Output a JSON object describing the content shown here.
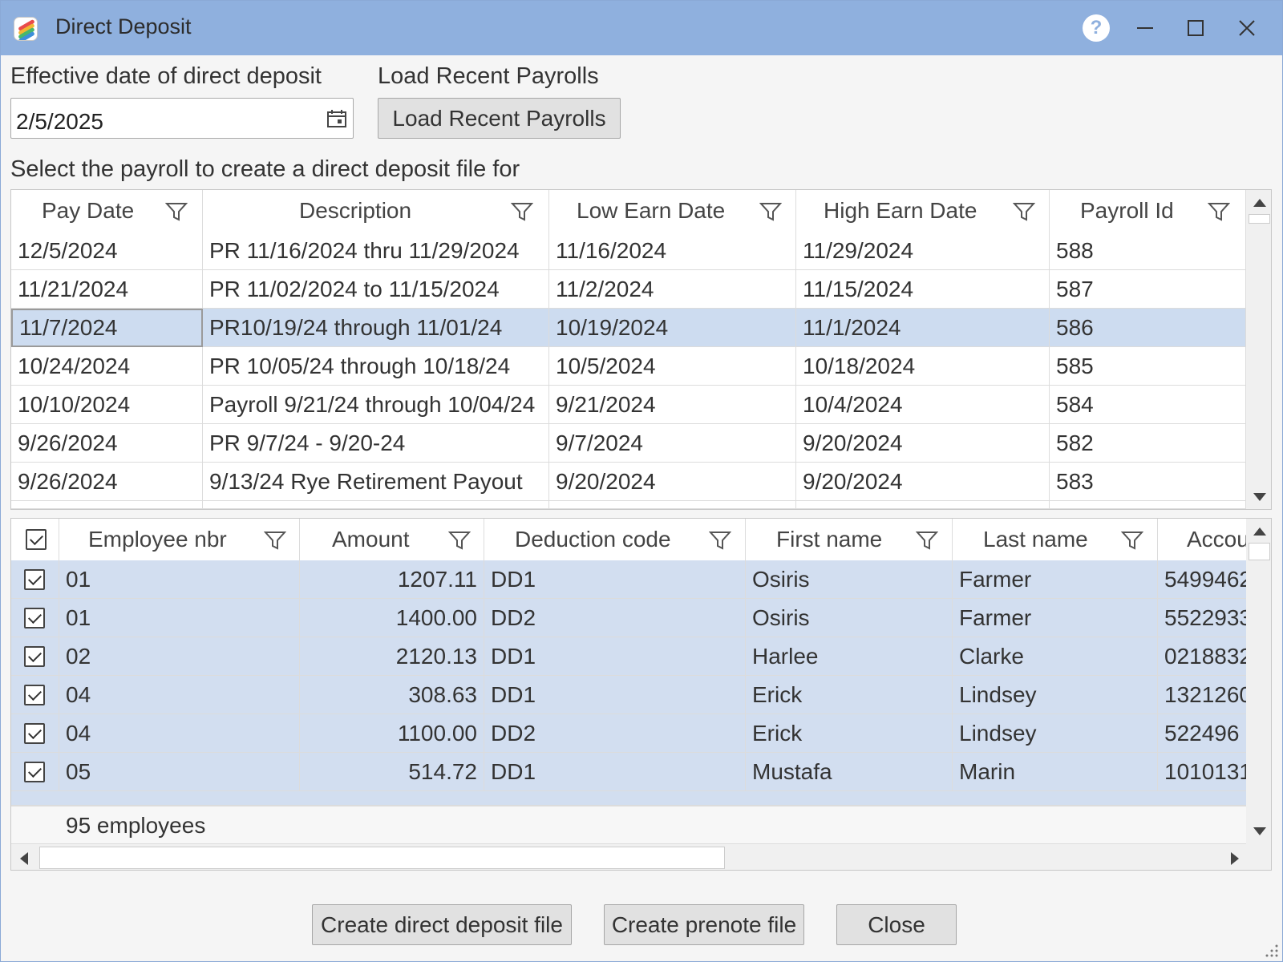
{
  "window": {
    "title": "Direct Deposit",
    "help_icon": "question-icon",
    "minimize_icon": "minimize-icon",
    "maximize_icon": "maximize-icon",
    "close_icon": "close-icon"
  },
  "effective_date": {
    "label": "Effective date of direct deposit",
    "value": "2/5/2025",
    "icon": "calendar-icon"
  },
  "load_recent": {
    "label": "Load Recent Payrolls",
    "button_label": "Load Recent Payrolls"
  },
  "payroll_section_label": "Select the payroll to create a direct deposit file for",
  "payrolls": {
    "columns": [
      "Pay Date",
      "Description",
      "Low Earn Date",
      "High Earn Date",
      "Payroll Id"
    ],
    "rows": [
      [
        "12/5/2024",
        "PR 11/16/2024 thru 11/29/2024",
        "11/16/2024",
        "11/29/2024",
        "588"
      ],
      [
        "11/21/2024",
        "PR 11/02/2024 to 11/15/2024",
        "11/2/2024",
        "11/15/2024",
        "587"
      ],
      [
        "11/7/2024",
        "PR10/19/24 through 11/01/24",
        "10/19/2024",
        "11/1/2024",
        "586"
      ],
      [
        "10/24/2024",
        "PR 10/05/24 through 10/18/24",
        "10/5/2024",
        "10/18/2024",
        "585"
      ],
      [
        "10/10/2024",
        "Payroll 9/21/24 through 10/04/24",
        "9/21/2024",
        "10/4/2024",
        "584"
      ],
      [
        "9/26/2024",
        "PR 9/7/24 - 9/20-24",
        "9/7/2024",
        "9/20/2024",
        "582"
      ],
      [
        "9/26/2024",
        "9/13/24 Rye Retirement Payout",
        "9/20/2024",
        "9/20/2024",
        "583"
      ]
    ],
    "selected_row": 2,
    "highlight_color": "#cddcf0"
  },
  "employees": {
    "columns": [
      "Employee nbr",
      "Amount",
      "Deduction code",
      "First name",
      "Last name",
      "Accou"
    ],
    "rows": [
      [
        "01",
        "1207.11",
        "DD1",
        "Osiris",
        "Farmer",
        "5499462"
      ],
      [
        "01",
        "1400.00",
        "DD2",
        "Osiris",
        "Farmer",
        "5522933"
      ],
      [
        "02",
        "2120.13",
        "DD1",
        "Harlee",
        "Clarke",
        "0218832"
      ],
      [
        "04",
        "308.63",
        "DD1",
        "Erick",
        "Lindsey",
        "1321260"
      ],
      [
        "04",
        "1100.00",
        "DD2",
        "Erick",
        "Lindsey",
        "522496"
      ],
      [
        "05",
        "514.72",
        "DD1",
        "Mustafa",
        "Marin",
        "1010131"
      ]
    ],
    "footer": "95 employees",
    "row_color": "#d2def0"
  },
  "actions": {
    "create_dd": "Create direct deposit file",
    "create_prenote": "Create prenote file",
    "close": "Close"
  }
}
